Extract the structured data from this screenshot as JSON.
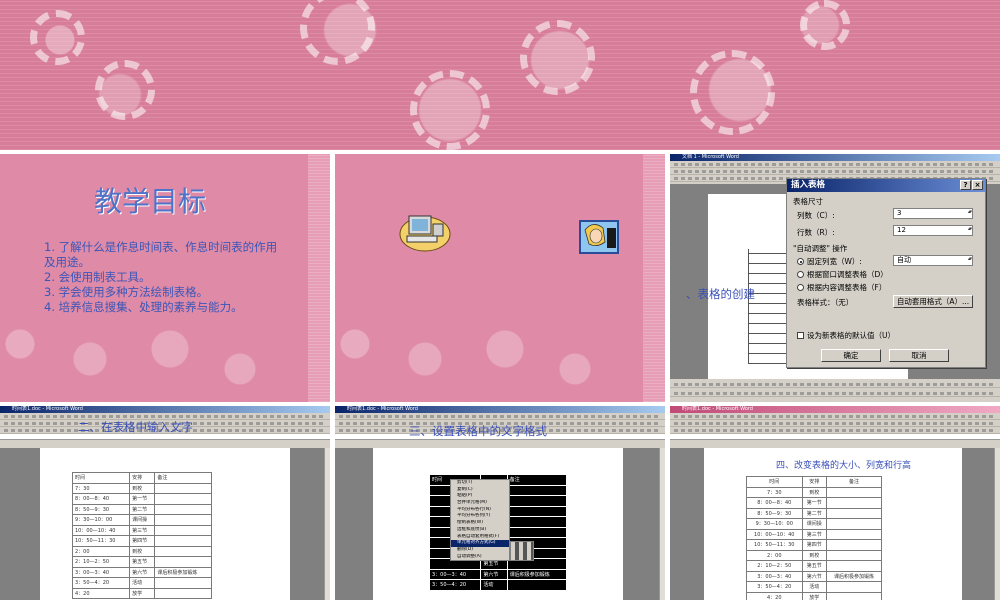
{
  "slide_top": {},
  "slide1": {
    "title": "教学目标",
    "goals": [
      "1. 了解什么是作息时间表、作息时间表的作用及用途。",
      "2. 会使用制表工具。",
      "3. 学会使用多种方法绘制表格。",
      "4. 培养信息搜集、处理的素养与能力。"
    ]
  },
  "slide3": {
    "window_title": "文档 1 - Microsoft Word",
    "caption": "、表格的创建",
    "dialog": {
      "title": "插入表格",
      "section_size": "表格尺寸",
      "columns_label": "列数（C）:",
      "columns_value": "3",
      "rows_label": "行数（R）:",
      "rows_value": "12",
      "section_auto": "\"自动调整\" 操作",
      "fixed_width_label": "固定列宽（W）:",
      "fixed_width_value": "自动",
      "fit_window": "根据窗口调整表格（D）",
      "fit_content": "根据内容调整表格（F）",
      "table_style_label": "表格样式：（无）",
      "autoformat_button": "自动套用格式（A）...",
      "default_checkbox": "设为新表格的默认值（U）",
      "ok": "确定",
      "cancel": "取消"
    }
  },
  "slide4": {
    "window_title": "时间表1.doc - Microsoft Word",
    "caption": "二、在表格中输入文字",
    "rows": [
      [
        "时间",
        "安排",
        "备注"
      ],
      [
        "7：30",
        "到校",
        ""
      ],
      [
        "8：00—8：40",
        "第一节",
        ""
      ],
      [
        "8：50—9：30",
        "第二节",
        ""
      ],
      [
        "9：30—10：00",
        "课间操",
        ""
      ],
      [
        "10：00—10：40",
        "第三节",
        ""
      ],
      [
        "10：50—11：30",
        "第四节",
        ""
      ],
      [
        "2：00",
        "到校",
        ""
      ],
      [
        "2：10—2：50",
        "第五节",
        ""
      ],
      [
        "3：00—3：40",
        "第六节",
        "课后积极参加锻炼"
      ],
      [
        "3：50—4：20",
        "活动",
        ""
      ],
      [
        "4：20",
        "放学",
        ""
      ]
    ]
  },
  "slide5": {
    "window_title": "时间表1.doc - Microsoft Word",
    "caption": "三、设置表格中的文字格式",
    "menu_items": [
      "剪切(T)",
      "复制(C)",
      "粘贴(P)",
      "合并单元格(M)",
      "平均分布各行(N)",
      "平均分布各列(Y)",
      "绘制表格(W)",
      "边框和底纹(B)",
      "表格自动套用格式(F)",
      "单元格对齐方式(G)",
      "删除(D)",
      "自动调整(A)"
    ],
    "rows": [
      [
        "时间",
        "",
        "备注"
      ],
      [
        "",
        "",
        ""
      ],
      [
        "",
        "",
        ""
      ],
      [
        "",
        "",
        ""
      ],
      [
        "",
        "",
        ""
      ],
      [
        "",
        "",
        ""
      ],
      [
        "",
        "",
        ""
      ],
      [
        "",
        "",
        ""
      ],
      [
        "",
        "第五节",
        ""
      ],
      [
        "3：00—3：40",
        "第六节",
        "课后积极参加锻炼"
      ],
      [
        "3：50—4：20",
        "活动",
        ""
      ]
    ]
  },
  "slide6": {
    "window_title": "时间表1.doc - Microsoft Word",
    "caption": "四、改变表格的大小、列宽和行高",
    "rows": [
      [
        "时间",
        "安排",
        "备注"
      ],
      [
        "7：30",
        "到校",
        ""
      ],
      [
        "8：00—8：40",
        "第一节",
        ""
      ],
      [
        "8：50—9：30",
        "第二节",
        ""
      ],
      [
        "9：30—10：00",
        "课间操",
        ""
      ],
      [
        "10：00—10：40",
        "第三节",
        ""
      ],
      [
        "10：50—11：30",
        "第四节",
        ""
      ],
      [
        "2：00",
        "到校",
        ""
      ],
      [
        "2：10—2：50",
        "第五节",
        ""
      ],
      [
        "3：00—3：40",
        "第六节",
        "课后积极参加锻炼"
      ],
      [
        "3：50—4：20",
        "活动",
        ""
      ],
      [
        "4：20",
        "放学",
        ""
      ]
    ]
  }
}
